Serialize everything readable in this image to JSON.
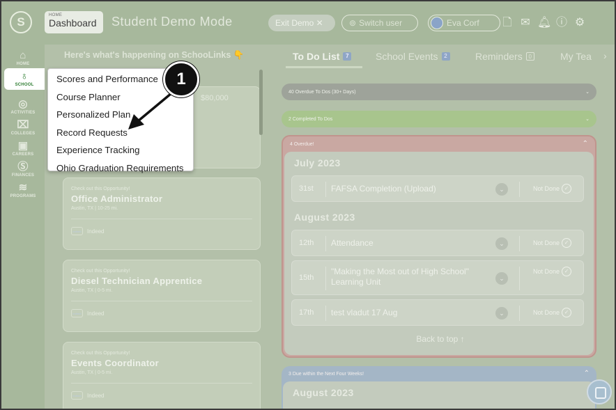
{
  "topbar": {
    "logo_glyph": "S",
    "breadcrumb_small": "HOME",
    "breadcrumb_main": "Dashboard",
    "mode_title": "Student Demo Mode",
    "exit_demo": "Exit Demo ✕",
    "switch_user": "Switch user",
    "user_name": "Eva Corf"
  },
  "sidebar": {
    "items": [
      {
        "label": "HOME",
        "icon": "home-icon"
      },
      {
        "label": "SCHOOL",
        "icon": "apple-icon"
      },
      {
        "label": "ACTIVITIES",
        "icon": "compass-icon"
      },
      {
        "label": "COLLEGES",
        "icon": "building-icon"
      },
      {
        "label": "CAREERS",
        "icon": "briefcase-icon"
      },
      {
        "label": "FINANCES",
        "icon": "moneybag-icon"
      },
      {
        "label": "PROGRAMS",
        "icon": "signal-icon"
      }
    ]
  },
  "feed": {
    "heading": "Here's what's happening on SchooLinks 👇",
    "salary": "$80,000",
    "cards": [
      {
        "kicker": "Check out this Opportunity!",
        "title": "Office Administrator",
        "location": "Austin, TX | 10-25 mi.",
        "source": "Indeed"
      },
      {
        "kicker": "Check out this Opportunity!",
        "title": "Diesel Technician Apprentice",
        "location": "Austin, TX | 0-5 mi.",
        "source": "Indeed"
      },
      {
        "kicker": "Check out this Opportunity!",
        "title": "Events Coordinator",
        "location": "Austin, TX | 0-5 mi.",
        "source": "Indeed"
      }
    ]
  },
  "tabs": [
    {
      "label": "To Do List",
      "badge": "7"
    },
    {
      "label": "School Events",
      "badge": "2"
    },
    {
      "label": "Reminders",
      "badge": "0"
    },
    {
      "label": "My Tea",
      "badge": ""
    }
  ],
  "todo": {
    "overdue_30": "40 Overdue To Dos (30+ Days)",
    "completed": "2 Completed To Dos",
    "overdue_label": "4 Overdue!",
    "months": [
      {
        "name": "July 2023",
        "items": [
          {
            "day": "31st",
            "text": "FAFSA Completion (Upload)",
            "status": "Not Done"
          }
        ]
      },
      {
        "name": "August 2023",
        "items": [
          {
            "day": "12th",
            "text": "Attendance",
            "status": "Not Done"
          },
          {
            "day": "15th",
            "text": "\"Making the Most out of High School\" Learning Unit",
            "status": "Not Done"
          },
          {
            "day": "17th",
            "text": "test vladut 17 Aug",
            "status": "Not Done"
          }
        ]
      }
    ],
    "back_to_top": "Back to top ↑",
    "due_soon_label": "3 Due within the Next Four Weeks!",
    "due_soon_month": "August 2023"
  },
  "dropdown": {
    "items": [
      "Scores and Performance",
      "Course Planner",
      "Personalized Plan",
      "Record Requests",
      "Experience Tracking",
      "Ohio Graduation Requirements"
    ]
  },
  "annotation": {
    "number": "1"
  }
}
